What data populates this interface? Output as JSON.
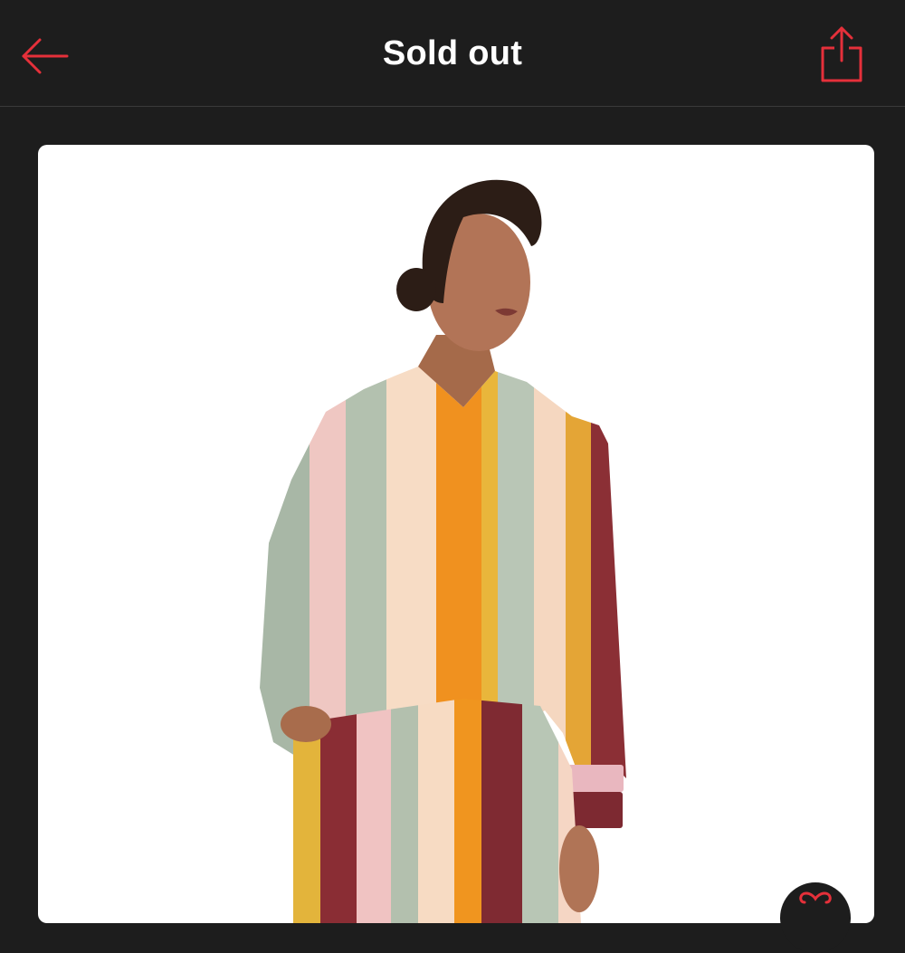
{
  "header": {
    "title": "Sold out",
    "back_icon": "arrow-left-icon",
    "share_icon": "share-icon"
  },
  "product": {
    "image_icon": "product-photo"
  },
  "favorite": {
    "icon": "heart-icon"
  },
  "colors": {
    "background": "#1d1d1d",
    "accent": "#e5303a",
    "title_text": "#ffffff",
    "card": "#ffffff"
  }
}
